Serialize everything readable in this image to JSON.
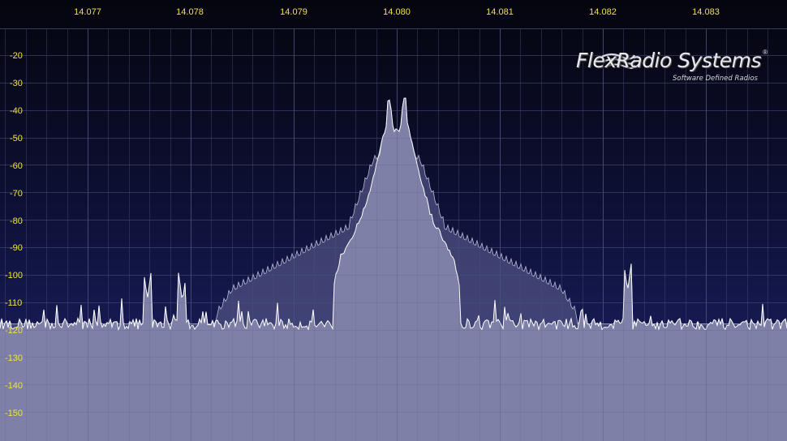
{
  "frequency_axis": {
    "labels": [
      "14.077",
      "14.078",
      "14.079",
      "14.080",
      "14.081",
      "14.082",
      "14.083"
    ],
    "values": [
      14.077,
      14.078,
      14.079,
      14.08,
      14.081,
      14.082,
      14.083
    ]
  },
  "db_axis": {
    "labels": [
      "-20",
      "-30",
      "-40",
      "-50",
      "-60",
      "-70",
      "-80",
      "-90",
      "-100",
      "-110",
      "-120",
      "-130",
      "-140",
      "-150"
    ],
    "values": [
      -20,
      -30,
      -40,
      -50,
      -60,
      -70,
      -80,
      -90,
      -100,
      -110,
      -120,
      -130,
      -140,
      -150
    ]
  },
  "logo": {
    "name": "FlexRadio Systems",
    "registered": "®",
    "tagline": "Software Defined Radios"
  },
  "trace": {
    "center_freq": 14.08,
    "noise_floor_db": -118,
    "peaks": [
      {
        "freq": 14.07992,
        "level_db": -32
      },
      {
        "freq": 14.08008,
        "level_db": -32
      }
    ],
    "spurs": [
      {
        "freq": 14.07758,
        "level_db": -109
      },
      {
        "freq": 14.07792,
        "level_db": -110
      },
      {
        "freq": 14.08224,
        "level_db": -106
      }
    ]
  },
  "colors": {
    "background_top": "#05050e",
    "background_bottom": "#161a52",
    "grid": "#4a4e78",
    "label": "#f2e24a",
    "fill": "#7f80a7",
    "trace": "#ffffff"
  }
}
